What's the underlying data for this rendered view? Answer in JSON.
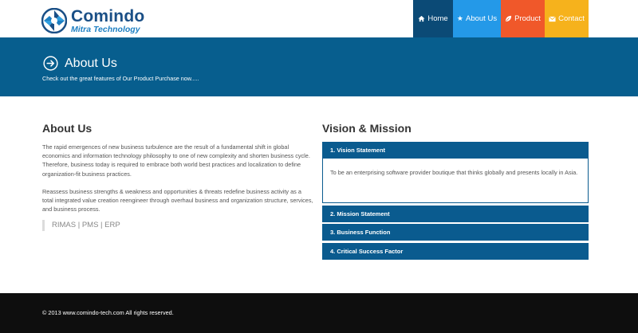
{
  "brand": {
    "name": "Comindo",
    "tagline": "Mitra Technology",
    "accent": "#1a4f86"
  },
  "nav": {
    "items": [
      {
        "label": "Home",
        "icon": "home-icon",
        "color": "#0b4a76"
      },
      {
        "label": "About Us",
        "icon": "star-icon",
        "color": "#2499e8"
      },
      {
        "label": "Product",
        "icon": "leaf-icon",
        "color": "#f0582a"
      },
      {
        "label": "Contact",
        "icon": "envelope-icon",
        "color": "#f6b21c"
      }
    ]
  },
  "banner": {
    "title": "About Us",
    "subtitle": "Check out the great features of Our Product Purchase now.....",
    "icon": "circle-arrow-right-icon",
    "color": "#075e8e"
  },
  "about": {
    "heading": "About Us",
    "paragraphs": [
      "The rapid emergences of new business turbulence are the result of a fundamental shift in global economics and information technology philosophy to one of new complexity and shorten business cycle. Therefore, business today is required to embrace both world best practices and localization to define organization-fit business practices.",
      "Reassess business strengths & weakness and opportunities & threats redefine business activity as a total integrated value creation reengineer through overhaul business and organization structure, services, and business process."
    ],
    "tagline": "RIMAS | PMS | ERP"
  },
  "vision": {
    "heading": "Vision & Mission",
    "sections": [
      {
        "title": "1. Vision Statement",
        "body": "To be an enterprising software provider boutique that thinks globally and presents locally in Asia.",
        "expanded": true
      },
      {
        "title": "2. Mission Statement",
        "expanded": false
      },
      {
        "title": "3. Business Function",
        "expanded": false
      },
      {
        "title": "4. Critical Success Factor",
        "expanded": false
      }
    ],
    "color": "#0a5b8f"
  },
  "footer": {
    "copyright": "© 2013 www.comindo-tech.com All rights reserved."
  }
}
